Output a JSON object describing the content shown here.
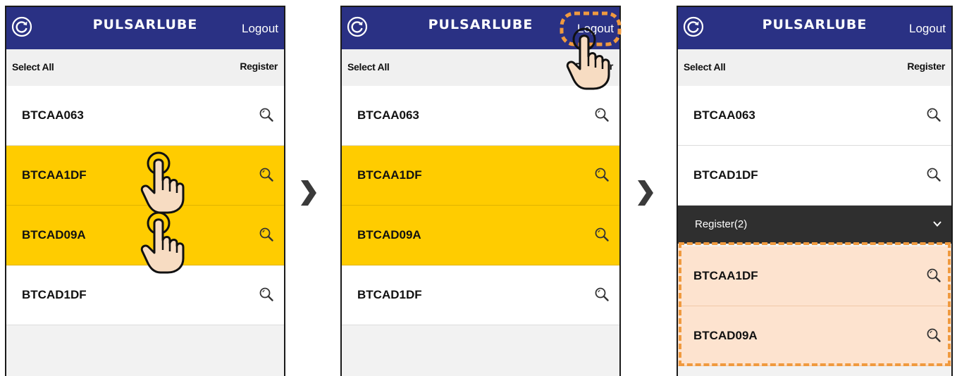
{
  "app": {
    "logo": "PULSARLUBE",
    "logout_label": "Logout",
    "select_all_label": "Select All",
    "register_label": "Register"
  },
  "colors": {
    "header": "#2a3184",
    "selected_row": "#ffcc00",
    "highlight_row": "#fde3cf",
    "group_bar": "#2f2f2f",
    "annotation": "#f09a3f"
  },
  "screens": [
    {
      "rows": [
        {
          "label": "BTCAA063",
          "selected": false
        },
        {
          "label": "BTCAA1DF",
          "selected": true
        },
        {
          "label": "BTCAD09A",
          "selected": true
        },
        {
          "label": "BTCAD1DF",
          "selected": false
        }
      ]
    },
    {
      "rows": [
        {
          "label": "BTCAA063",
          "selected": true
        },
        {
          "label": "BTCAA1DF",
          "selected": true
        },
        {
          "label": "BTCAD09A",
          "selected": true
        },
        {
          "label": "BTCAD1DF",
          "selected": false
        }
      ]
    },
    {
      "rows": [
        {
          "label": "BTCAA063"
        },
        {
          "label": "BTCAD1DF"
        }
      ],
      "group": {
        "label": "Register(2)"
      },
      "registered": [
        {
          "label": "BTCAA1DF"
        },
        {
          "label": "BTCAD09A"
        }
      ]
    }
  ],
  "icons": {
    "refresh": "refresh-icon",
    "search": "magnifier-icon",
    "chevron": "chevron-down-icon",
    "hand": "hand-pointer-icon",
    "step_arrow": "chevron-right-icon"
  }
}
